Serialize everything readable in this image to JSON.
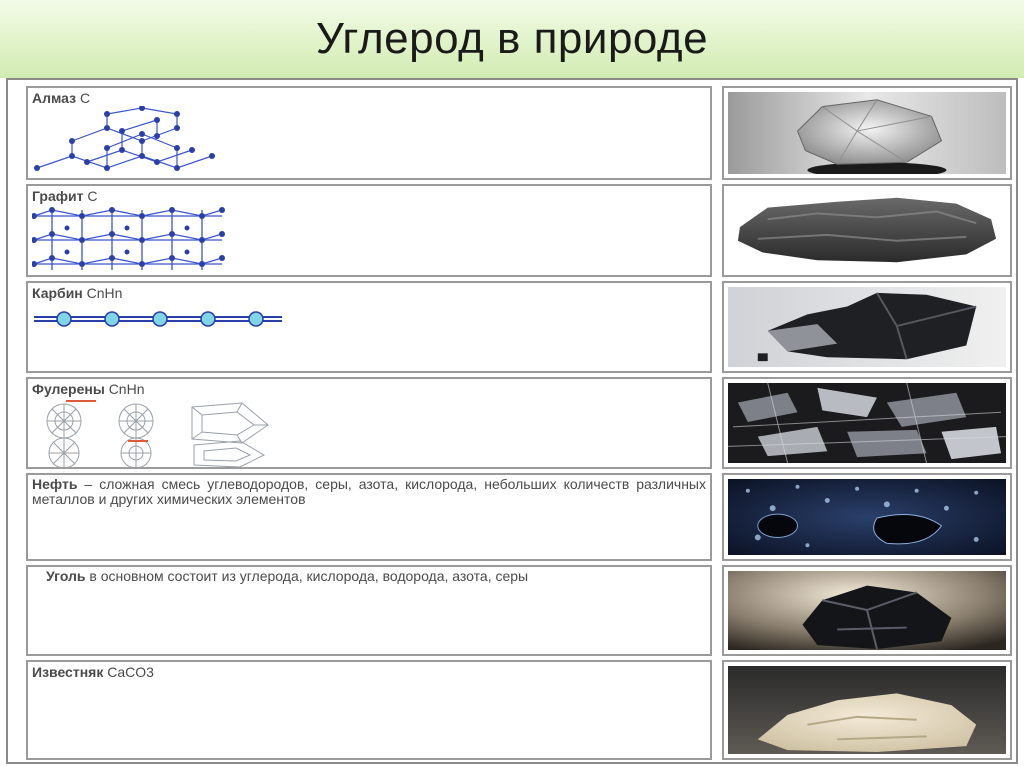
{
  "title": "Углерод в природе",
  "rows": [
    {
      "id": "diamond",
      "label": "Алмаз",
      "formula": "С"
    },
    {
      "id": "graphite",
      "label": "Графит",
      "formula": "С"
    },
    {
      "id": "carbyne",
      "label": "Карбин",
      "formula": "СnНn"
    },
    {
      "id": "fullerene",
      "label": "Фулерены",
      "formula": "СnНn"
    },
    {
      "id": "oil",
      "label": "Нефть",
      "text": " – сложная смесь углеводородов, серы, азота, кислорода, небольших количеств различных металлов и других химических элементов"
    },
    {
      "id": "coal",
      "label": "Уголь",
      "text": " в основном состоит из углерода, кислорода, водорода, азота, серы"
    },
    {
      "id": "limestone",
      "label": "Известняк",
      "formula": "CaCO3"
    }
  ],
  "colors": {
    "atom": "#2b3fa8",
    "bond": "#3a56c9",
    "chain_atom": "#7fd6e6",
    "title_bg": "#dff2c6"
  }
}
